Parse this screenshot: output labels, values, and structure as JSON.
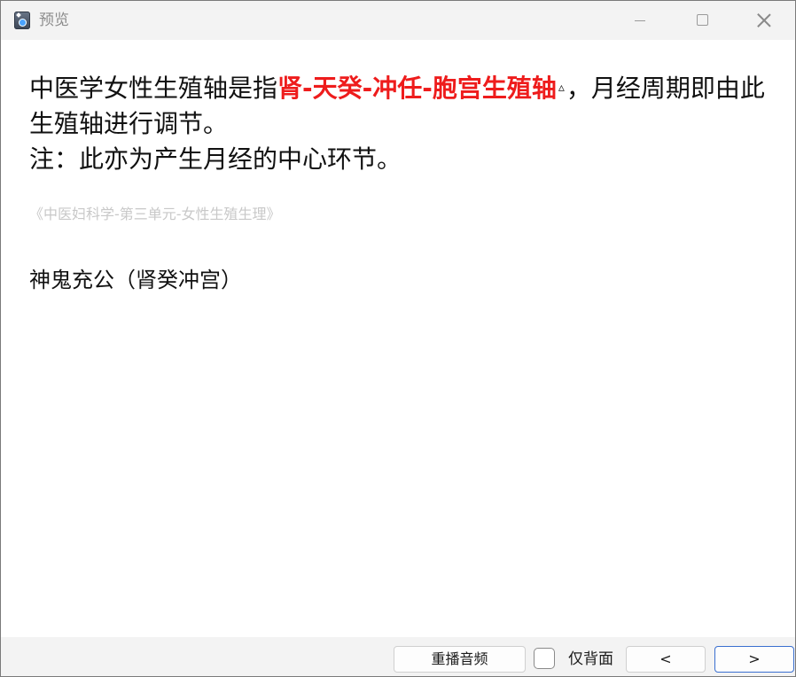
{
  "window": {
    "title": "预览",
    "app_icon": "app-star-icon",
    "controls": {
      "minimize_icon": "minimize-icon",
      "maximize_icon": "maximize-icon",
      "close_icon": "close-icon"
    }
  },
  "card": {
    "line1_prefix": "中医学女性生殖轴是指",
    "line1_highlight": "肾-天癸-冲任-胞宫生殖轴",
    "highlight_color": "#ee1c1c",
    "line1_marker": "▵",
    "line1_suffix": "，月经周期即由此生殖轴进行调节。",
    "line2": "注：此亦为产生月经的中心环节。",
    "source": "《中医妇科学-第三单元-女性生殖生理》",
    "mnemonic": "神鬼充公（肾癸冲宫）"
  },
  "bottombar": {
    "replay_label": "重播音频",
    "back_only_checked": false,
    "back_only_label": "仅背面",
    "prev_label": "<",
    "next_label": ">"
  }
}
